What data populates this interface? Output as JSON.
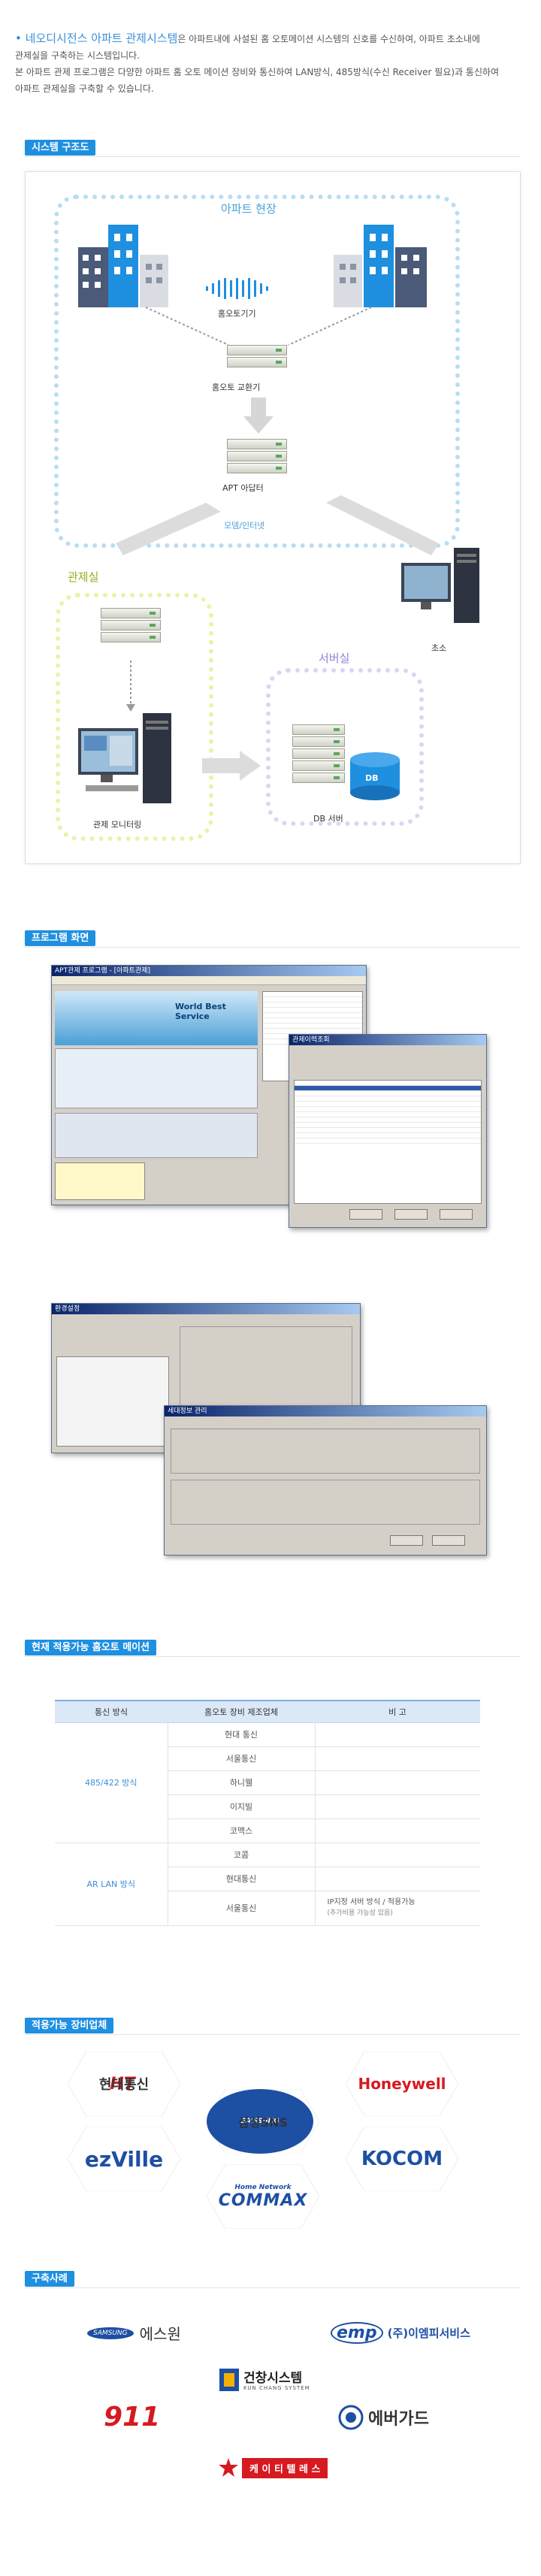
{
  "intro": {
    "title": "네오디시전스 아파트 관제시스템",
    "title_rest": "은 아파트내에 사설된 홈 오토메이션 시스템의 신호를 수신하여, 아파트 초소내에",
    "line2": "관제실을 구축하는 시스템입니다.",
    "line3": "본 아파트 관제 프로그램은 다양한 아파트 홈 오토 메이션 장비와 통신하여 LAN방식, 485방식(수신 Receiver 필요)과 통신하여",
    "line4": "아파트 관제실을 구축할 수 있습니다."
  },
  "sections": {
    "diagram": "시스템 구조도",
    "program": "프로그램 화면",
    "compat": "현재 적용가능 홈오토 메이션",
    "vendors": "적용가능 장비업체",
    "cases": "구축사례"
  },
  "diagram": {
    "site": "아파트 현장",
    "home_auto": "홈오토기기",
    "exchanger": "홈오토 교환기",
    "adapter": "APT 아답터",
    "relay": "모뎀/인터넷",
    "control": "관제실",
    "monitor": "관제 모니터링",
    "server_room": "서버실",
    "db": "DB",
    "db_server": "DB 서버",
    "guard": "초소"
  },
  "screens": {
    "w1": "APT관제 프로그램 - [아파트관제]",
    "w1_banner": "World Best Service",
    "w2": "관제이력조회",
    "w3": "환경설정",
    "w4": "세대정보 관리"
  },
  "table": {
    "headers": [
      "통신 방식",
      "홈오토 장비 제조업체",
      "비 고"
    ],
    "groups": [
      {
        "name": "485/422 방식",
        "rows": [
          "현대 통신",
          "서울통신",
          "하니웰",
          "이지빌",
          "코맥스"
        ]
      },
      {
        "name": "AR LAN 방식",
        "rows": [
          "코콤",
          "현대통신",
          "서울통신"
        ]
      }
    ],
    "note1": "IP지정 서버 방식 / 적용가능",
    "note2": "(추가비용 가능성 있음)"
  },
  "vendors": [
    "현대통신",
    "Honeywell",
    "삼성SNS",
    "ezVille",
    "KOCOM",
    "COMMAX"
  ],
  "vendor_extra": {
    "samsung": "SAMSUNG",
    "home_network": "Home Network"
  },
  "cases": [
    "에스원",
    "(주)이엠피서비스",
    "건창시스템",
    "911",
    "에버가드",
    "케 이 티 텔 레 스"
  ],
  "case_extra": {
    "samsung": "SAMSUNG",
    "emp": "emp",
    "kc_sub": "KUN CHANG SYSTEM"
  },
  "colors": {
    "accent": "#1f8fe0",
    "dash_site": "#b8ddf4",
    "dash_control": "#e9f3a6",
    "dash_server": "#d8d6f4",
    "db": "#1f8fe0"
  }
}
